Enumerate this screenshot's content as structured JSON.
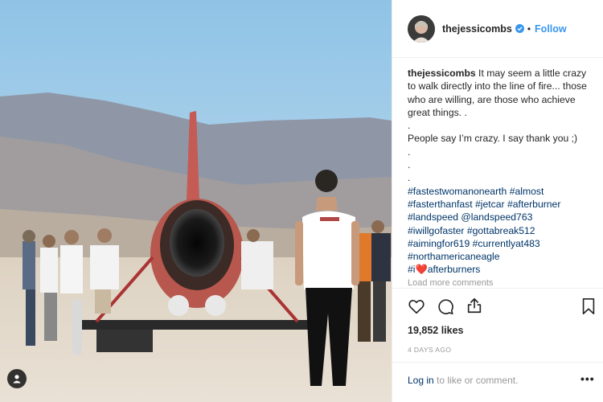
{
  "post": {
    "username": "thejessicombs",
    "follow_label": "Follow",
    "separator": "•",
    "caption_user": "thejessicombs",
    "caption_lines": [
      " It may seem a little crazy to walk directly into the line of fire... those who are willing, are those who achieve great things. .",
      ".",
      "People say I’m crazy. I say thank you ;)",
      ".",
      ".",
      "."
    ],
    "hashtag_lines": [
      [
        "#fastestwomanonearth",
        " ",
        "#almost"
      ],
      [
        "#fasterthanfast",
        " ",
        "#jetcar",
        " ",
        "#afterburner"
      ],
      [
        "#landspeed",
        " ",
        "@landspeed763"
      ],
      [
        "#iwillgofaster",
        " ",
        "#gottabreak512"
      ],
      [
        "#aimingfor619",
        " ",
        "#currentlyat483"
      ],
      [
        "#northamericaneagle"
      ]
    ],
    "last_line": {
      "prefix": "#i",
      "emoji": "❤️",
      "suffix": "afterburners"
    },
    "load_more": "Load more comments",
    "likes": "19,852 likes",
    "time_ago": "4 DAYS AGO",
    "login_link": "Log in",
    "login_rest": " to like or comment.",
    "more_options": "•••"
  },
  "icons": {
    "verified": "verified-badge-icon",
    "heart": "heart-icon",
    "comment": "comment-bubble-icon",
    "share": "share-icon",
    "bookmark": "bookmark-icon",
    "profile": "user-profile-icon"
  },
  "colors": {
    "link_blue": "#3897f0",
    "hashtag": "#003569",
    "secondary_text": "#999999",
    "border": "#efefef"
  }
}
